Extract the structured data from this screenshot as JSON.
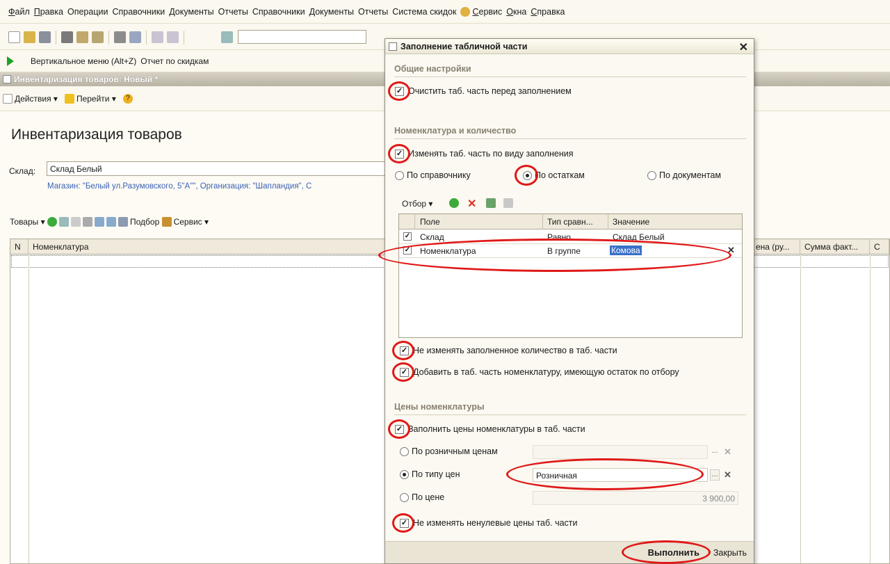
{
  "menu": {
    "items": [
      "Файл",
      "Правка",
      "Операции",
      "Справочники",
      "Документы",
      "Отчеты",
      "Справочники",
      "Документы",
      "Отчеты",
      "Система скидок",
      "Сервис",
      "Окна",
      "Справка"
    ]
  },
  "toolbar2": {
    "vertical_menu": "Вертикальное меню (Alt+Z)",
    "discount_report": "Отчет по скидкам"
  },
  "window": {
    "title": "Инвентаризация товаров: Новый *"
  },
  "formbar": {
    "actions": "Действия",
    "goto": "Перейти"
  },
  "document": {
    "title": "Инвентаризация товаров",
    "warehouse_label": "Склад:",
    "warehouse_value": "Склад Белый",
    "shop_info": "Магазин: \"Белый ул.Разумовского, 5\"А\"\", Организация: \"Шапландия\", С",
    "goods_label": "Товары",
    "podbor": "Подбор",
    "service": "Сервис",
    "columns": [
      "N",
      "Номенклатура",
      "ена (ру...",
      "Сумма факт...",
      "С"
    ]
  },
  "dialog": {
    "title": "Заполнение табличной части",
    "general_section": "Общие настройки",
    "clear_label": "Очистить таб. часть перед заполнением",
    "nomen_section": "Номенклатура и количество",
    "change_by_type": "Изменять таб. часть по виду заполнения",
    "radio_catalog": "По справочнику",
    "radio_stock": "По остаткам",
    "radio_docs": "По документам",
    "filter_label": "Отбор",
    "filter_headers": [
      "Поле",
      "Тип сравн...",
      "Значение"
    ],
    "filter_rows": [
      {
        "checked": true,
        "field": "Склад",
        "type": "Равно",
        "value": "Склад Белый"
      },
      {
        "checked": true,
        "field": "Номенклатура",
        "type": "В группе",
        "value": "Комова"
      }
    ],
    "no_change_qty": "Не изменять заполненное количество в таб. части",
    "add_nomen": "Добавить в таб. часть номенклатуру, имеющую остаток по отбору",
    "prices_section": "Цены номенклатуры",
    "fill_prices": "Заполнить цены номенклатуры в таб. части",
    "price_retail": "По розничным ценам",
    "price_type": "По типу цен",
    "price_type_value": "Розничная",
    "price_fixed": "По цене",
    "price_fixed_value": "3 900,00",
    "no_change_prices": "Не изменять ненулевые цены таб. части",
    "execute": "Выполнить",
    "close": "Закрыть"
  }
}
